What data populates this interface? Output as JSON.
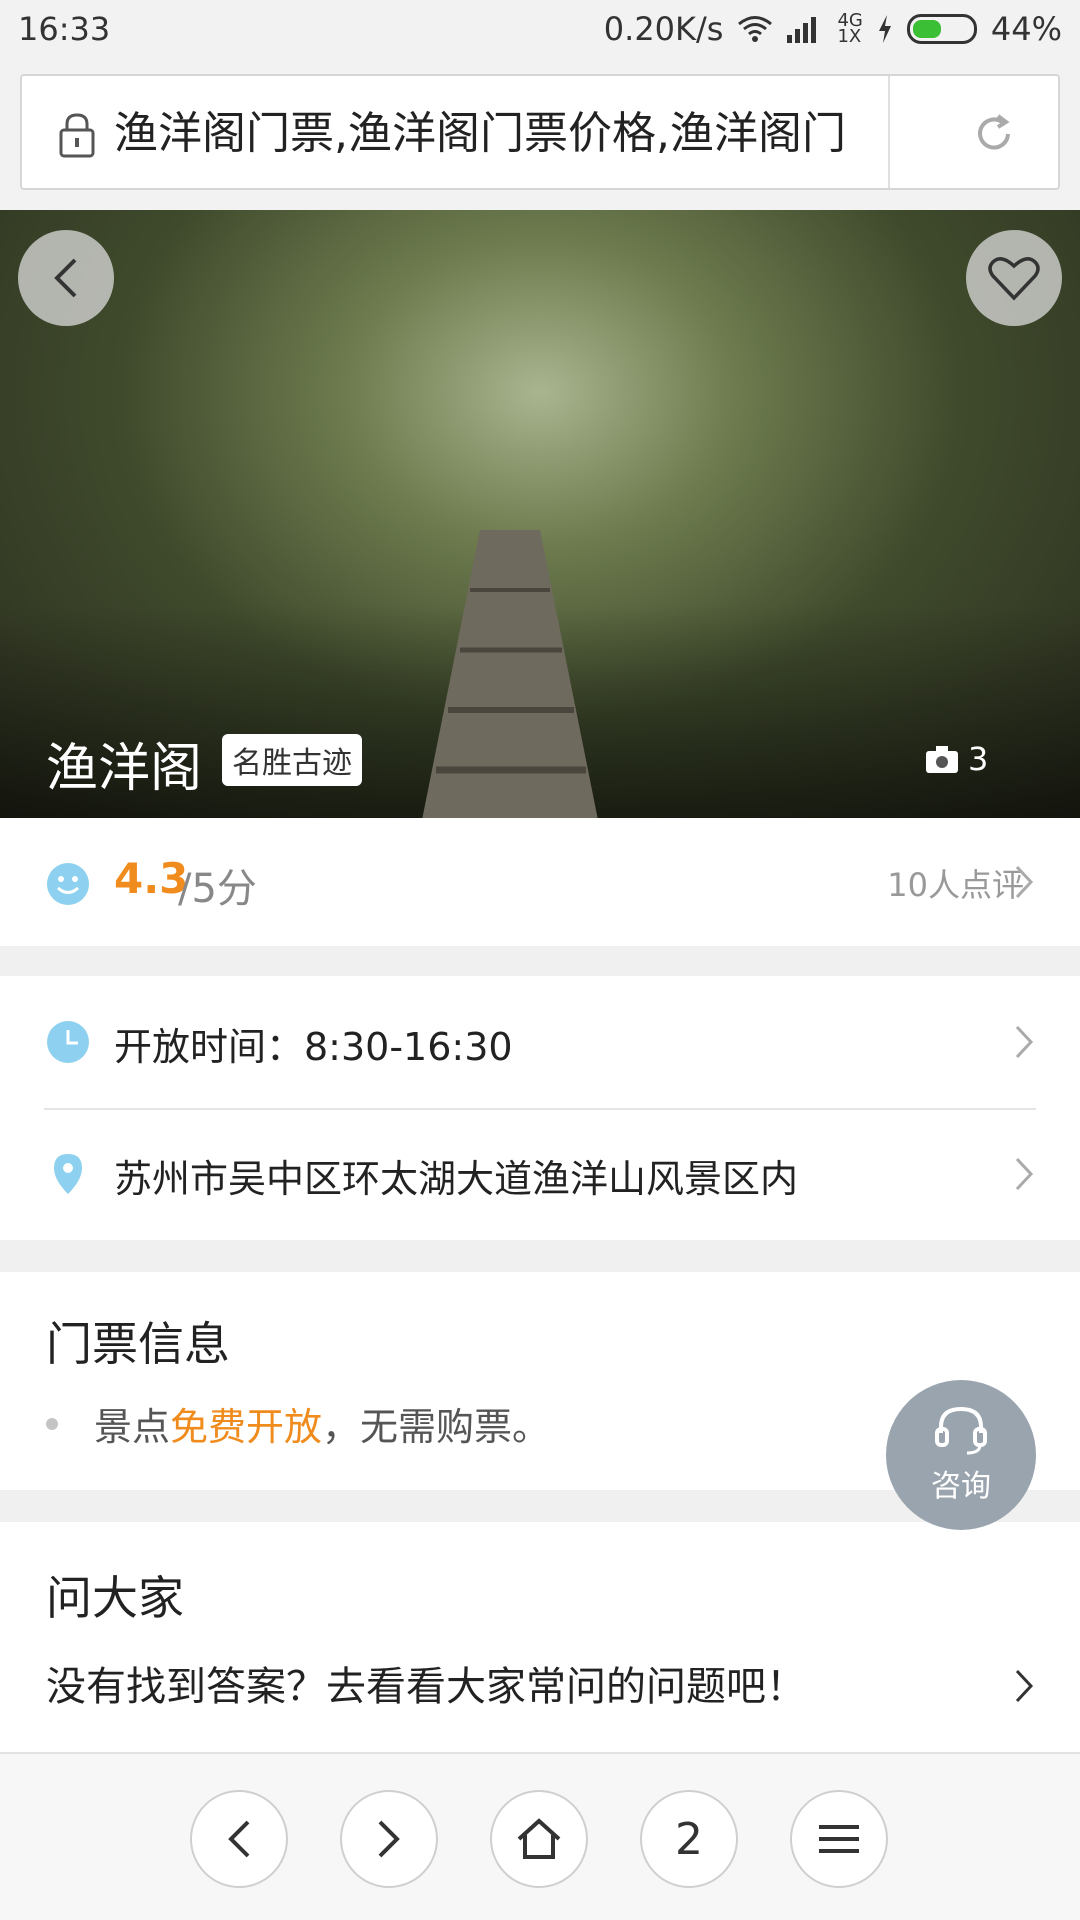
{
  "status_bar": {
    "time": "16:33",
    "speed": "0.20K/s",
    "network": "4G",
    "sim": "1X",
    "battery": "44%"
  },
  "url_bar": {
    "text": "渔洋阁门票,渔洋阁门票价格,渔洋阁门"
  },
  "hero": {
    "title": "渔洋阁",
    "badge": "名胜古迹",
    "photo_count": "3"
  },
  "rating": {
    "score": "4.3",
    "max": "/5分",
    "reviews": "10人点评"
  },
  "info": {
    "hours": "开放时间：8:30-16:30",
    "address": "苏州市吴中区环太湖大道渔洋山风景区内"
  },
  "tickets": {
    "title": "门票信息",
    "prefix": "景点",
    "highlight": "免费开放",
    "suffix": "，无需购票。"
  },
  "ask": {
    "title": "问大家",
    "prompt": "没有找到答案？去看看大家常问的问题吧！"
  },
  "consult": {
    "label": "咨询"
  },
  "bottom_nav": {
    "tabs_count": "2"
  },
  "colors": {
    "accent": "#f08c1e",
    "icon_blue": "#8dd0f0",
    "consult_bg": "#9aa4ae"
  }
}
